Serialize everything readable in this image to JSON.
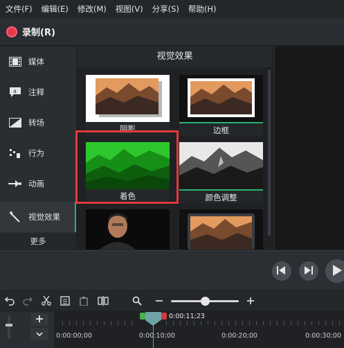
{
  "menu": [
    "文件(F)",
    "编辑(E)",
    "修改(M)",
    "视图(V)",
    "分享(S)",
    "帮助(H)"
  ],
  "record": {
    "label": "录制(R)"
  },
  "sidebar": {
    "items": [
      {
        "label": "媒体",
        "icon": "film-icon"
      },
      {
        "label": "注释",
        "icon": "annotation-icon"
      },
      {
        "label": "转场",
        "icon": "transition-icon"
      },
      {
        "label": "行为",
        "icon": "behavior-icon"
      },
      {
        "label": "动画",
        "icon": "animation-icon"
      },
      {
        "label": "视觉效果",
        "icon": "magic-wand-icon",
        "active": true
      }
    ],
    "more": "更多"
  },
  "panel": {
    "title": "视觉效果",
    "thumbs": [
      {
        "caption": "阴影"
      },
      {
        "caption": "边框"
      },
      {
        "caption": "着色",
        "selected": true
      },
      {
        "caption": "颜色调整"
      },
      {
        "caption": ""
      },
      {
        "caption": ""
      }
    ]
  },
  "timeline": {
    "playhead_time": "0:00:11;23",
    "ruler_labels": [
      "0:00:00;00",
      "0:00:10;00",
      "0:00:20;00",
      "0:00:30;00"
    ]
  },
  "colors": {
    "accent": "#27b46e",
    "record": "#e8394a",
    "selection": "#e43a3a",
    "playhead": "#6fa3a8"
  }
}
